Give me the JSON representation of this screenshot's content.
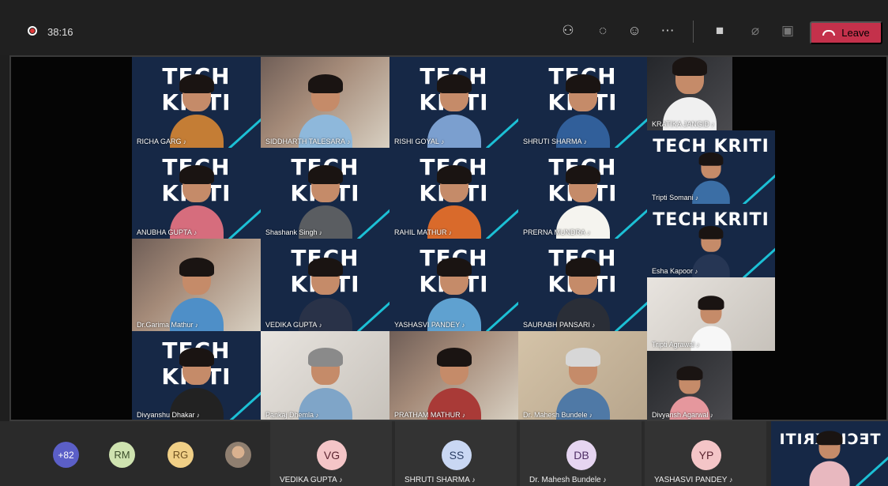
{
  "meeting": {
    "timer": "38:16",
    "leave_label": "Leave"
  },
  "tiles": [
    {
      "name": "RICHA GARG",
      "brand": "TECH KRITI"
    },
    {
      "name": "SIDDHARTH TALESARA",
      "brand": ""
    },
    {
      "name": "RISHI GOYAL",
      "brand": "TECH KRITI"
    },
    {
      "name": "SHRUTI SHARMA",
      "brand": "TECH KRITI"
    },
    {
      "name": "KRATIKA JANGID",
      "brand": ""
    },
    {
      "name": "ANUBHA GUPTA",
      "brand": "TECH KRITI"
    },
    {
      "name": "Shashank Singh",
      "brand": "TECH KRITI"
    },
    {
      "name": "RAHIL MATHUR",
      "brand": "TECH KRITI"
    },
    {
      "name": "PRERNA MUNDRA",
      "brand": "TECH KRITI"
    },
    {
      "name": "Tripti Somani",
      "brand": "TECH KRITI"
    },
    {
      "name": "Dr.Garima Mathur",
      "brand": ""
    },
    {
      "name": "VEDIKA GUPTA",
      "brand": "TECH KRITI"
    },
    {
      "name": "YASHASVI PANDEY",
      "brand": "TECH KRITI"
    },
    {
      "name": "SAURABH PANSARI",
      "brand": "TECH KRITI"
    },
    {
      "name": "Esha Kapoor",
      "brand": "TECH KRITI"
    },
    {
      "name": "Divyanshu Dhakar",
      "brand": "TECH KRITI"
    },
    {
      "name": "Pankaj Dhemla",
      "brand": ""
    },
    {
      "name": "PRATHAM MATHUR",
      "brand": ""
    },
    {
      "name": "Dr. Mahesh Bundele",
      "brand": ""
    },
    {
      "name": "Tripti Agrawal",
      "brand": ""
    },
    {
      "name": "Divyansh Agarwal",
      "brand": ""
    }
  ],
  "bottom_bar": {
    "overflow_count": "+82",
    "avatars": [
      "RM",
      "RG"
    ],
    "cards": [
      {
        "initials": "VG",
        "name": "VEDIKA GUPTA"
      },
      {
        "initials": "SS",
        "name": "SHRUTI SHARMA"
      },
      {
        "initials": "DB",
        "name": "Dr. Mahesh Bundele"
      },
      {
        "initials": "YP",
        "name": "YASHASVI PANDEY"
      }
    ],
    "self_brand": "TECH KRITI"
  },
  "colors": {
    "leave": "#c4314b",
    "brand_stripe": "#1cc0d5",
    "overflow_badge": "#5b5fc7"
  }
}
